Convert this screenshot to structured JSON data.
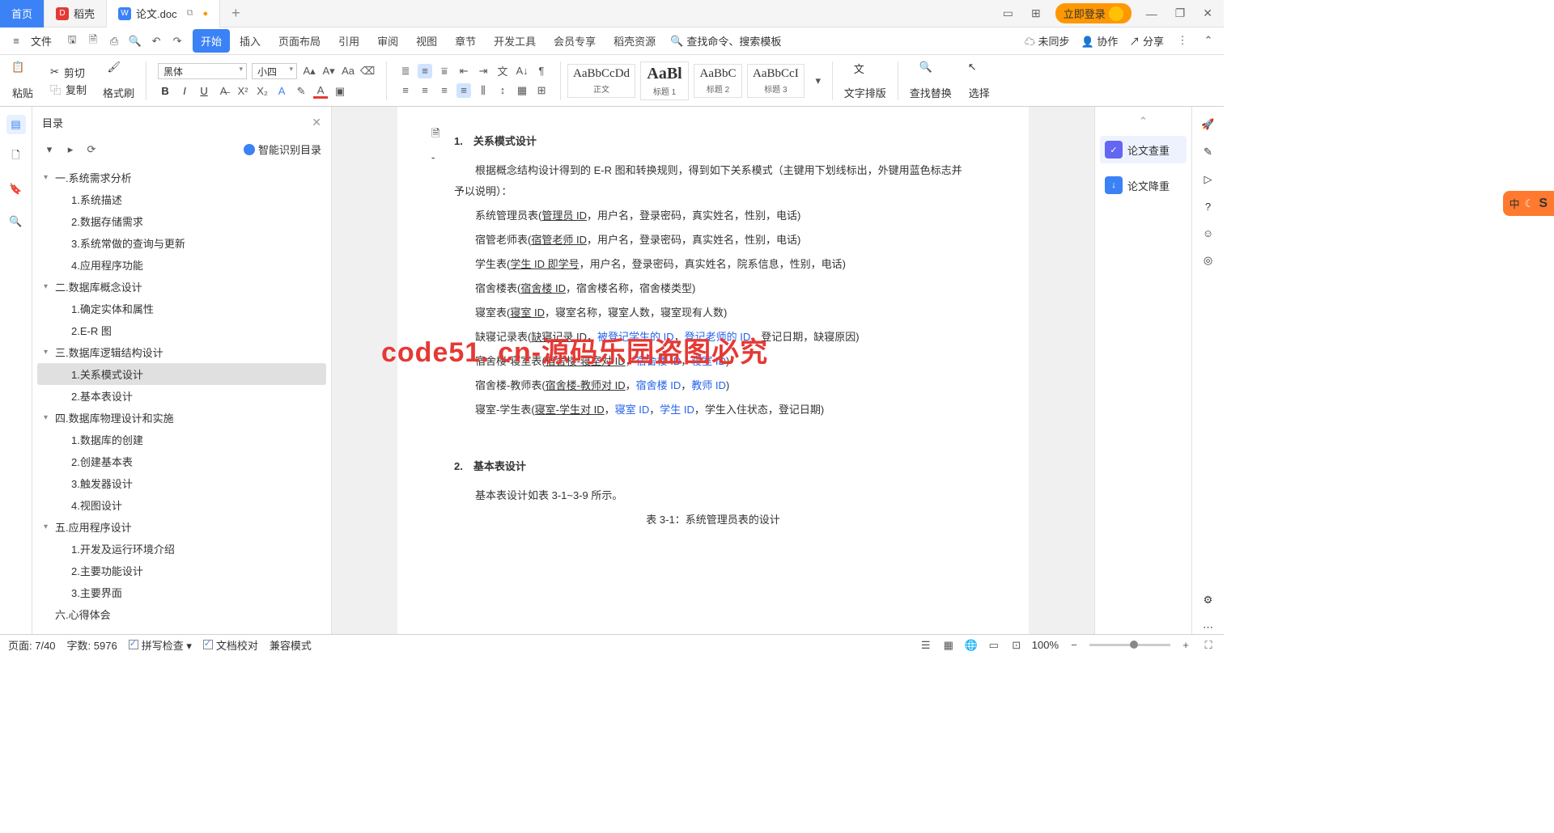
{
  "tabs": {
    "home": "首页",
    "docker": "稻壳",
    "doc": "论文.doc"
  },
  "login": "立即登录",
  "menu": {
    "file": "文件"
  },
  "ribbonTabs": [
    "开始",
    "插入",
    "页面布局",
    "引用",
    "审阅",
    "视图",
    "章节",
    "开发工具",
    "会员专享",
    "稻壳资源"
  ],
  "searchPlaceholder": "查找命令、搜索模板",
  "sync": "未同步",
  "collab": "协作",
  "share": "分享",
  "clipboard": {
    "paste": "粘贴",
    "cut": "剪切",
    "copy": "复制",
    "format": "格式刷"
  },
  "font": {
    "name": "黑体",
    "size": "小四"
  },
  "styles": [
    {
      "p": "AaBbCcDd",
      "n": "正文"
    },
    {
      "p": "AaBl",
      "n": "标题 1"
    },
    {
      "p": "AaBbC",
      "n": "标题 2"
    },
    {
      "p": "AaBbCcI",
      "n": "标题 3"
    }
  ],
  "groups": {
    "typeset": "文字排版",
    "find": "查找替换",
    "select": "选择"
  },
  "outline": {
    "title": "目录",
    "smart": "智能识别目录",
    "items": [
      {
        "l": 1,
        "t": "一.系统需求分析",
        "c": true
      },
      {
        "l": 2,
        "t": "1.系统描述"
      },
      {
        "l": 2,
        "t": "2.数据存储需求"
      },
      {
        "l": 2,
        "t": "3.系统常做的查询与更新"
      },
      {
        "l": 2,
        "t": "4.应用程序功能"
      },
      {
        "l": 1,
        "t": "二.数据库概念设计",
        "c": true
      },
      {
        "l": 2,
        "t": "1.确定实体和属性"
      },
      {
        "l": 2,
        "t": "2.E-R 图"
      },
      {
        "l": 1,
        "t": "三.数据库逻辑结构设计",
        "c": true
      },
      {
        "l": 2,
        "t": "1.关系模式设计",
        "sel": true
      },
      {
        "l": 2,
        "t": "2.基本表设计"
      },
      {
        "l": 1,
        "t": "四.数据库物理设计和实施",
        "c": true
      },
      {
        "l": 2,
        "t": "1.数据库的创建"
      },
      {
        "l": 2,
        "t": "2.创建基本表"
      },
      {
        "l": 2,
        "t": "3.触发器设计"
      },
      {
        "l": 2,
        "t": "4.视图设计"
      },
      {
        "l": 1,
        "t": "五.应用程序设计",
        "c": true
      },
      {
        "l": 2,
        "t": "1.开发及运行环境介绍"
      },
      {
        "l": 2,
        "t": "2.主要功能设计"
      },
      {
        "l": 2,
        "t": "3.主要界面"
      },
      {
        "l": 1,
        "t": "六.心得体会"
      }
    ]
  },
  "doc": {
    "h1": "1.　关系模式设计",
    "p1a": "根据概念结构设计得到的 E-R 图和转换规则，得到如下关系模式（主键用下划线标出，外键用蓝色标志并予以说明）：",
    "l1": {
      "a": "系统管理员表(",
      "u": "管理员 ID",
      "b": "，用户名，登录密码，真实姓名，性别，电话)"
    },
    "l2": {
      "a": "宿管老师表(",
      "u": "宿管老师 ID",
      "b": "，用户名，登录密码，真实姓名，性别，电话)"
    },
    "l3": {
      "a": "学生表(",
      "u": "学生 ID 即学号",
      "b": "，用户名，登录密码，真实姓名，院系信息，性别，电话)"
    },
    "l4": {
      "a": "宿舍楼表(",
      "u": "宿舍楼 ID",
      "b": "，宿舍楼名称，宿舍楼类型)"
    },
    "l5": {
      "a": "寝室表(",
      "u": "寝室 ID",
      "b": "，寝室名称，寝室人数，寝室现有人数)"
    },
    "l6": {
      "a": "缺寝记录表(",
      "u": "缺寝记录 ID",
      "b": "，",
      "f1": "被登记学生的 ID",
      "c": "，",
      "f2": "登记老师的 ID",
      "d": "，登记日期，缺寝原因)"
    },
    "l7": {
      "a": "宿舍楼-寝室表(",
      "u": "宿舍楼-寝室对 ID",
      "b": "，",
      "f1": "宿舍楼 ID",
      "c": "，",
      "f2": "寝室 ID",
      "d": ")"
    },
    "l8": {
      "a": "宿舍楼-教师表(",
      "u": "宿舍楼-教师对 ID",
      "b": "，",
      "f1": "宿舍楼 ID",
      "c": "，",
      "f2": "教师 ID",
      "d": ")"
    },
    "l9": {
      "a": "寝室-学生表(",
      "u": "寝室-学生对 ID",
      "b": "，",
      "f1": "寝室 ID",
      "c": "，",
      "f2": "学生 ID",
      "d": "，学生入住状态，登记日期)"
    },
    "h2": "2.　基本表设计",
    "p2": "基本表设计如表 3-1~3-9 所示。",
    "cap": "表 3-1：系统管理员表的设计",
    "wm": "code51. cn-源码乐园盗图必究"
  },
  "rightPanel": {
    "a": "论文查重",
    "b": "论文降重"
  },
  "ime": "中",
  "status": {
    "page": "页面: 7/40",
    "words": "字数: 5976",
    "spell": "拼写检查",
    "proof": "文档校对",
    "compat": "兼容模式",
    "zoom": "100%"
  }
}
